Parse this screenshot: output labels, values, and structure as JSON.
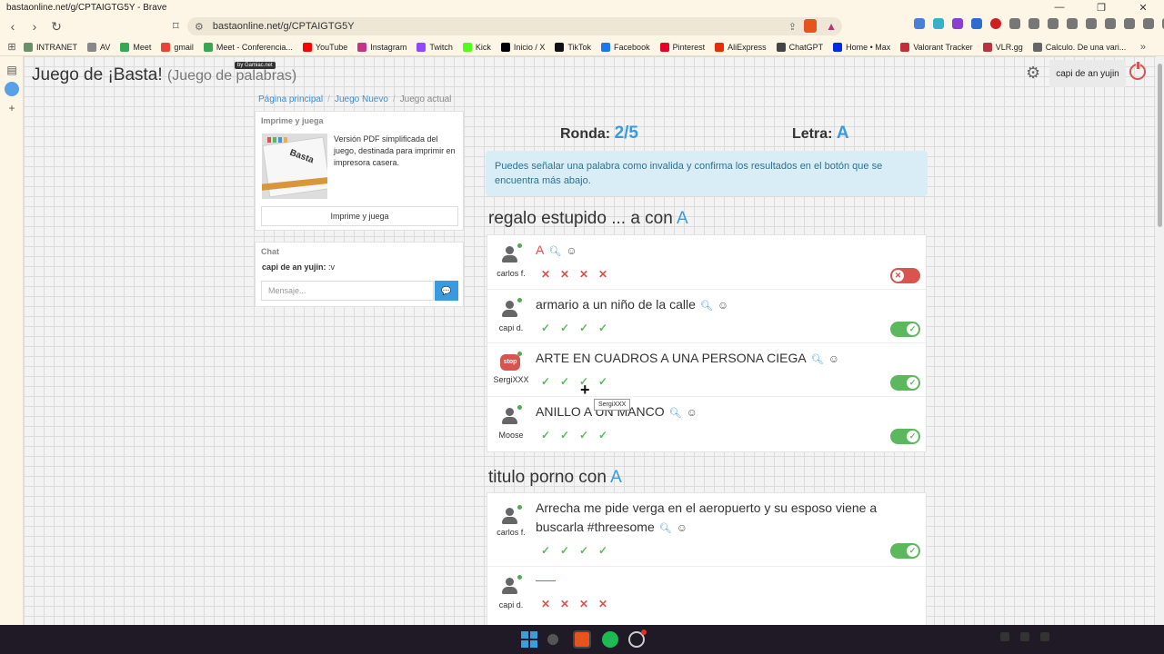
{
  "browser": {
    "window_title": "bastaonline.net/g/CPTAIGTG5Y - Brave",
    "url": "bastaonline.net/g/CPTAIGTG5Y",
    "bookmarks": [
      {
        "label": "INTRANET",
        "color": "#6a8f6a"
      },
      {
        "label": "AV",
        "color": "#888888"
      },
      {
        "label": "Meet",
        "color": "#34a853"
      },
      {
        "label": "gmail",
        "color": "#ea4335"
      },
      {
        "label": "Meet - Conferencia...",
        "color": "#34a853"
      },
      {
        "label": "YouTube",
        "color": "#ff0000"
      },
      {
        "label": "Instagram",
        "color": "#c13584"
      },
      {
        "label": "Twitch",
        "color": "#9146ff"
      },
      {
        "label": "Kick",
        "color": "#53fc18"
      },
      {
        "label": "Inicio / X",
        "color": "#000000"
      },
      {
        "label": "TikTok",
        "color": "#111111"
      },
      {
        "label": "Facebook",
        "color": "#1877f2"
      },
      {
        "label": "Pinterest",
        "color": "#e60023"
      },
      {
        "label": "AliExpress",
        "color": "#e62e04"
      },
      {
        "label": "ChatGPT",
        "color": "#444444"
      },
      {
        "label": "Home • Max",
        "color": "#002be7"
      },
      {
        "label": "Valorant Tracker",
        "color": "#c0303a"
      },
      {
        "label": "VLR.gg",
        "color": "#b83240"
      },
      {
        "label": "Calculo. De una vari...",
        "color": "#666666"
      }
    ]
  },
  "app": {
    "title": "Juego de ¡Basta!",
    "subtitle": "(Juego de palabras)",
    "badge": "by Gamiac.net",
    "user_button": "capi de an yujin"
  },
  "breadcrumb": [
    "Página principal",
    "Juego Nuevo",
    "Juego actual"
  ],
  "print_panel": {
    "heading": "Imprime y juega",
    "description": "Versión PDF simplificada del juego, destinada para imprimir en impresora casera.",
    "image_word": "Basta",
    "button": "Imprime y juega"
  },
  "chat": {
    "heading": "Chat",
    "messages": [
      {
        "user": "capi de an yujin:",
        "text": ":v"
      }
    ],
    "placeholder": "Mensaje..."
  },
  "round": {
    "label": "Ronda:",
    "value": "2/5"
  },
  "letter": {
    "label": "Letra:",
    "value": "A"
  },
  "info": "Puedes señalar una palabra como invalida y confirma los resultados en el botón que se encuentra más abajo.",
  "categories": [
    {
      "title": "regalo estupido ... a con",
      "letter": "A",
      "rows": [
        {
          "player": "carlos f.",
          "answer": "A",
          "valid": false
        },
        {
          "player": "capi d.",
          "answer": "armario a un niño de la calle",
          "valid": true
        },
        {
          "player": "SergiXXX",
          "answer": "ARTE EN CUADROS A UNA PERSONA CIEGA",
          "valid": true
        },
        {
          "player": "Moose",
          "answer": "ANILLO A UN MANCO",
          "valid": true
        }
      ]
    },
    {
      "title": "titulo porno con",
      "letter": "A",
      "rows": [
        {
          "player": "carlos f.",
          "answer": "Arrecha me pide verga en el aeropuerto y su esposo viene a buscarla #threesome",
          "valid": true
        },
        {
          "player": "capi d.",
          "answer": "",
          "valid": false
        }
      ]
    }
  ],
  "stop_avatar_text": "stop",
  "tooltip": "SergiXXX",
  "colors": {
    "accent": "#3a9ae0",
    "valid": "#5cb85c",
    "invalid": "#d9534f",
    "info_bg": "#d9edf7"
  }
}
